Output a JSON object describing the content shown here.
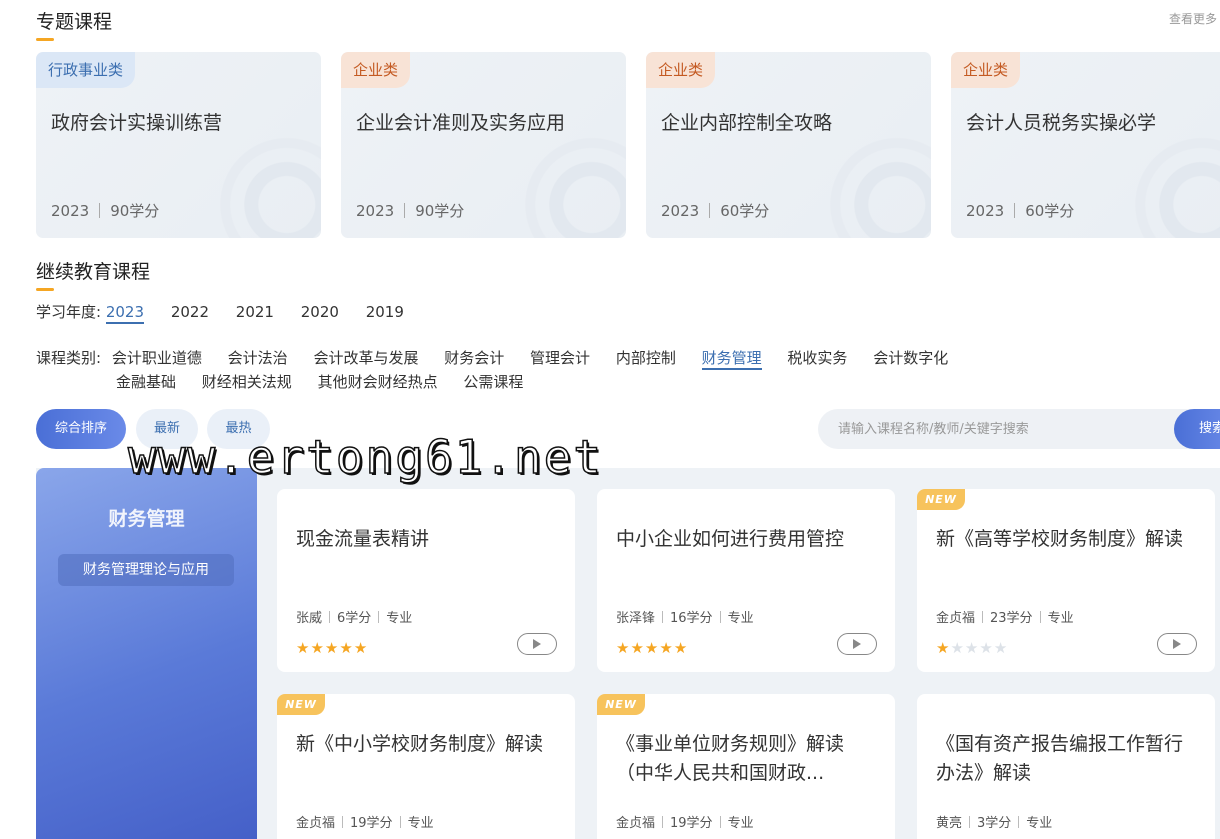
{
  "topics": {
    "title": "专题课程",
    "more": "查看更多",
    "cards": [
      {
        "tag": "行政事业类",
        "name": "政府会计实操训练营",
        "year": "2023",
        "credits": "90学分"
      },
      {
        "tag": "企业类",
        "name": "企业会计准则及实务应用",
        "year": "2023",
        "credits": "90学分"
      },
      {
        "tag": "企业类",
        "name": "企业内部控制全攻略",
        "year": "2023",
        "credits": "60学分"
      },
      {
        "tag": "企业类",
        "name": "会计人员税务实操必学",
        "year": "2023",
        "credits": "60学分"
      }
    ]
  },
  "continuing": {
    "title": "继续教育课程",
    "year_label": "学习年度:",
    "years": [
      "2023",
      "2022",
      "2021",
      "2020",
      "2019"
    ],
    "category_label": "课程类别:",
    "categories_row1": [
      "会计职业道德",
      "会计法治",
      "会计改革与发展",
      "财务会计",
      "管理会计",
      "内部控制",
      "财务管理",
      "税收实务",
      "会计数字化"
    ],
    "categories_row2": [
      "金融基础",
      "财经相关法规",
      "其他财会财经热点",
      "公需课程"
    ],
    "sort": [
      "综合排序",
      "最新",
      "最热"
    ],
    "search": {
      "placeholder": "请输入课程名称/教师/关键字搜索",
      "button": "搜索"
    }
  },
  "panel": {
    "title": "财务管理",
    "subtitle": "财务管理理论与应用"
  },
  "courses": [
    {
      "title": "现金流量表精讲",
      "teacher": "张威",
      "credits": "6学分",
      "type": "专业",
      "stars": 5,
      "new": false,
      "new_label": ""
    },
    {
      "title": "中小企业如何进行费用管控",
      "teacher": "张泽锋",
      "credits": "16学分",
      "type": "专业",
      "stars": 5,
      "new": false,
      "new_label": ""
    },
    {
      "title": "新《高等学校财务制度》解读",
      "teacher": "金贞福",
      "credits": "23学分",
      "type": "专业",
      "stars": 1,
      "new": true,
      "new_label": "NEW"
    },
    {
      "title": "新《中小学校财务制度》解读",
      "teacher": "金贞福",
      "credits": "19学分",
      "type": "专业",
      "new": true,
      "new_label": "NEW"
    },
    {
      "title": "《事业单位财务规则》解读（中华人民共和国财政...",
      "teacher": "金贞福",
      "credits": "19学分",
      "type": "专业",
      "new": true,
      "new_label": "NEW"
    },
    {
      "title": "《国有资产报告编报工作暂行办法》解读",
      "teacher": "黄亮",
      "credits": "3学分",
      "type": "专业",
      "new": false,
      "new_label": ""
    }
  ],
  "watermark": "www.ertong61.net"
}
